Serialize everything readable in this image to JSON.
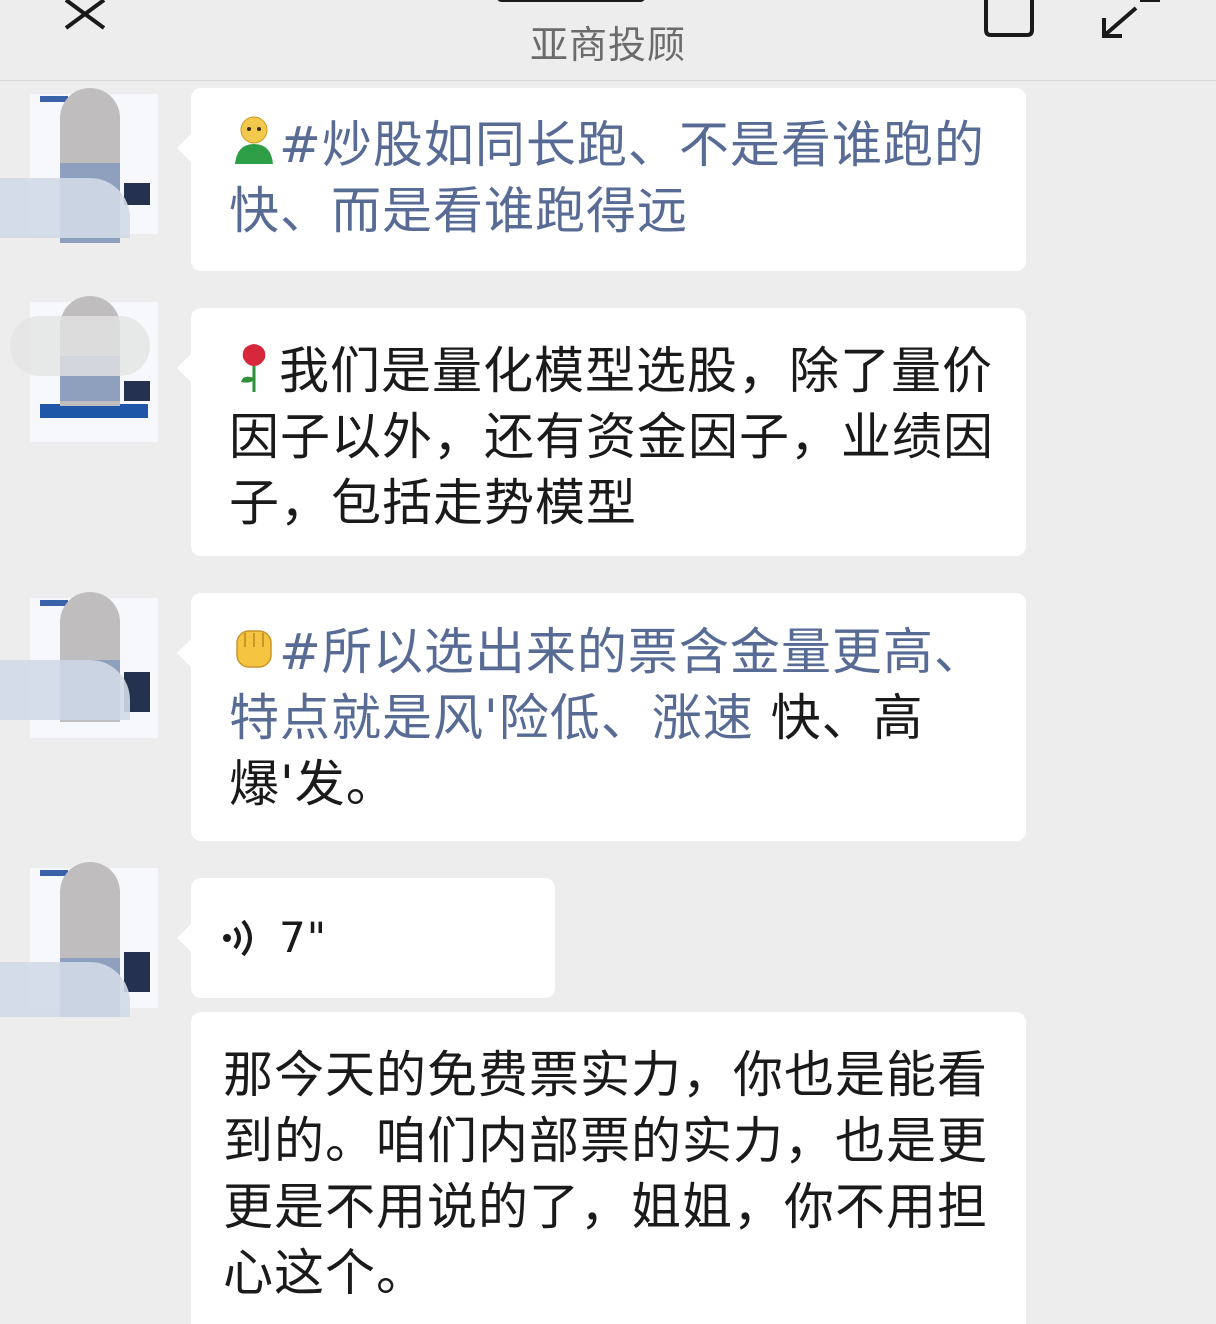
{
  "header": {
    "subtitle": "亚商投顾"
  },
  "messages": [
    {
      "emoji": "user-emoji",
      "link_text": "#炒股如同长跑、不是看谁跑的快、而是看谁跑得远",
      "text": ""
    },
    {
      "emoji": "rose-emoji",
      "text": "我们是量化模型选股，除了量价因子以外，还有资金因子，业绩因子，包括走势模型"
    },
    {
      "emoji": "fist-emoji",
      "link_text": "#所以选出来的票含金量更高、特点就是风'险低、涨速",
      "text": " 快、高爆'发。"
    },
    {
      "voice_duration": "7\""
    },
    {
      "text": "那今天的免费票实力，你也是能看到的。咱们内部票的实力，也是更更是不用说的了，姐姐，你不用担心这个。"
    }
  ],
  "colors": {
    "background": "#ededed",
    "bubble": "#ffffff",
    "link": "#576b95",
    "text": "#1a1a1a"
  }
}
